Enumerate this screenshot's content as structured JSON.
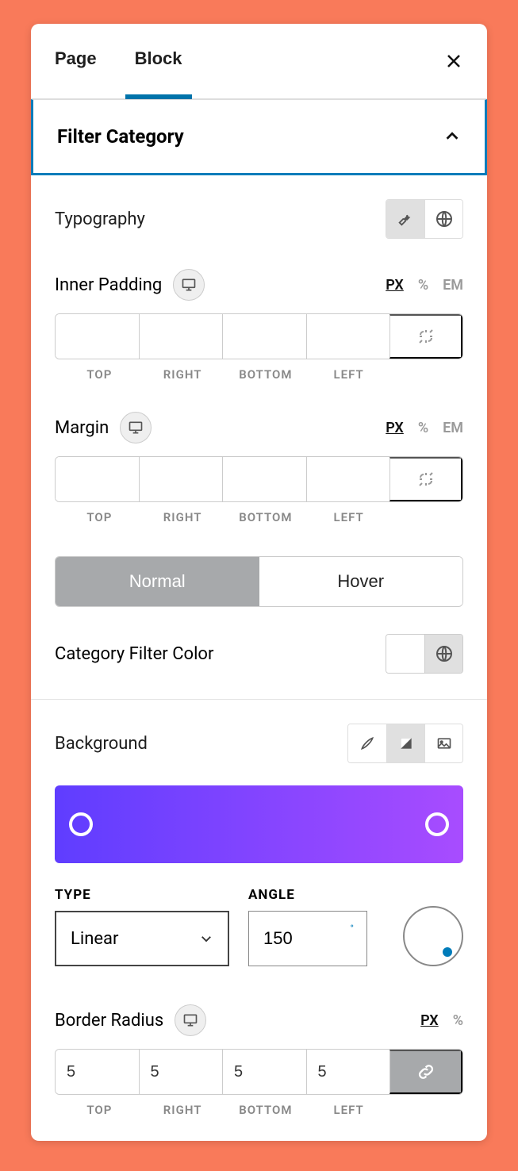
{
  "header": {
    "tabs": {
      "page": "Page",
      "block": "Block"
    },
    "active_tab": "block"
  },
  "section": {
    "title": "Filter Category",
    "expanded": true
  },
  "typography": {
    "label": "Typography"
  },
  "inner_padding": {
    "label": "Inner Padding",
    "units": [
      "PX",
      "%",
      "EM"
    ],
    "active_unit": "PX",
    "values": {
      "top": "",
      "right": "",
      "bottom": "",
      "left": ""
    },
    "sides": {
      "top": "TOP",
      "right": "RIGHT",
      "bottom": "BOTTOM",
      "left": "LEFT"
    }
  },
  "margin": {
    "label": "Margin",
    "units": [
      "PX",
      "%",
      "EM"
    ],
    "active_unit": "PX",
    "values": {
      "top": "",
      "right": "",
      "bottom": "",
      "left": ""
    },
    "sides": {
      "top": "TOP",
      "right": "RIGHT",
      "bottom": "BOTTOM",
      "left": "LEFT"
    }
  },
  "state_tabs": {
    "normal": "Normal",
    "hover": "Hover",
    "active": "normal"
  },
  "category_color": {
    "label": "Category Filter Color",
    "value": "#ffffff"
  },
  "background": {
    "label": "Background",
    "mode": "gradient",
    "gradient": {
      "start": "#5f3dff",
      "end": "#a84cff",
      "type_label": "TYPE",
      "type_value": "Linear",
      "angle_label": "ANGLE",
      "angle_value": "150"
    }
  },
  "border_radius": {
    "label": "Border Radius",
    "units": [
      "PX",
      "%"
    ],
    "active_unit": "PX",
    "values": {
      "top": "5",
      "right": "5",
      "bottom": "5",
      "left": "5"
    },
    "sides": {
      "top": "TOP",
      "right": "RIGHT",
      "bottom": "BOTTOM",
      "left": "LEFT"
    },
    "linked": true
  }
}
